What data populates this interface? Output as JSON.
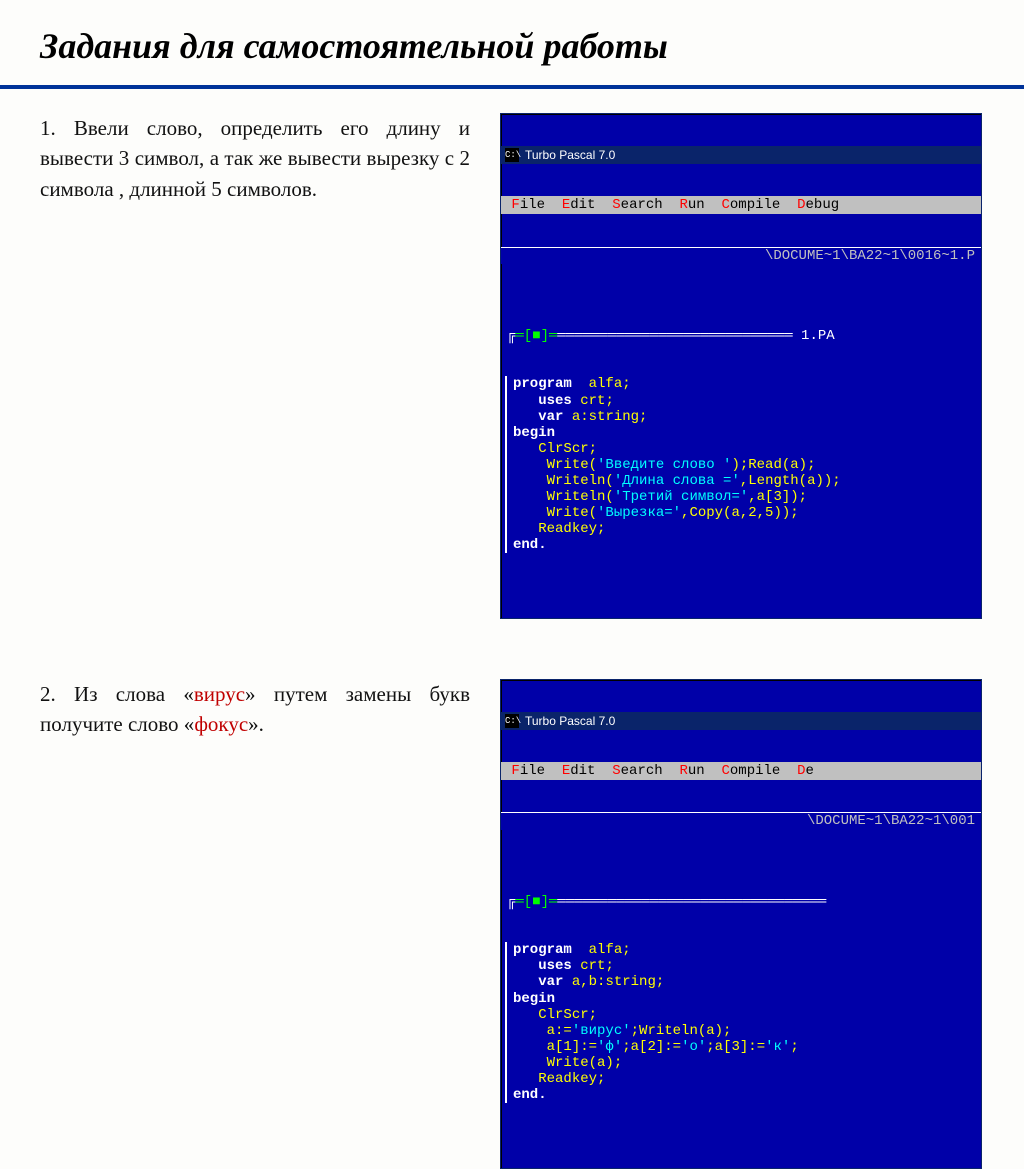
{
  "title": "Задания для самостоятельной работы",
  "tasks": [
    {
      "num": "1.",
      "body": "Ввели слово, определить его длину и вывести 3 символ, а так же вывести вырезку с 2 символа , длинной 5 символов.",
      "highlight_red_words": []
    },
    {
      "num": "2.",
      "body_pre": "Из слова «",
      "w1": "вирус",
      "body_mid": "» путем замены букв  получите слово «",
      "w2": "фокус",
      "body_post": "»."
    }
  ],
  "tp": {
    "title": "Turbo Pascal 7.0",
    "menu": {
      "file": "File",
      "edit": "Edit",
      "search": "Search",
      "run": "Run",
      "compile": "Compile",
      "debug": "Debug",
      "d2": "De"
    },
    "path1": "\\DOCUME~1\\BA22~1\\0016~1.P",
    "path2": "\\DOCUME~1\\BA22~1\\001",
    "frame_top1": "═[■]══════════════════════════════ 1.PA",
    "frame_top2": "═[■]══════════════════════════════════"
  },
  "code1": [
    {
      "t": "kw",
      "v": "program"
    },
    {
      "t": "txt",
      "v": "  "
    },
    {
      "t": "id",
      "v": "alfa;"
    },
    {
      "t": "nl"
    },
    {
      "t": "txt",
      "v": "   "
    },
    {
      "t": "kw",
      "v": "uses"
    },
    {
      "t": "txt",
      "v": " "
    },
    {
      "t": "id",
      "v": "crt;"
    },
    {
      "t": "nl"
    },
    {
      "t": "txt",
      "v": "   "
    },
    {
      "t": "kw",
      "v": "var"
    },
    {
      "t": "txt",
      "v": " "
    },
    {
      "t": "id",
      "v": "a:string;"
    },
    {
      "t": "nl"
    },
    {
      "t": "kw",
      "v": "begin"
    },
    {
      "t": "nl"
    },
    {
      "t": "txt",
      "v": "   "
    },
    {
      "t": "id",
      "v": "ClrScr;"
    },
    {
      "t": "nl"
    },
    {
      "t": "txt",
      "v": "    "
    },
    {
      "t": "id",
      "v": "Write("
    },
    {
      "t": "str",
      "v": "'Введите слово '"
    },
    {
      "t": "id",
      "v": ");Read(a);"
    },
    {
      "t": "nl"
    },
    {
      "t": "txt",
      "v": "    "
    },
    {
      "t": "id",
      "v": "Writeln("
    },
    {
      "t": "str",
      "v": "'Длина слова ='"
    },
    {
      "t": "id",
      "v": ",Length(a));"
    },
    {
      "t": "nl"
    },
    {
      "t": "txt",
      "v": "    "
    },
    {
      "t": "id",
      "v": "Writeln("
    },
    {
      "t": "str",
      "v": "'Третий символ='"
    },
    {
      "t": "id",
      "v": ",a[3]);"
    },
    {
      "t": "nl"
    },
    {
      "t": "txt",
      "v": "    "
    },
    {
      "t": "id",
      "v": "Write("
    },
    {
      "t": "str",
      "v": "'Вырезка='"
    },
    {
      "t": "id",
      "v": ",Copy(a,2,5));"
    },
    {
      "t": "nl"
    },
    {
      "t": "txt",
      "v": "   "
    },
    {
      "t": "id",
      "v": "Readkey;"
    },
    {
      "t": "nl"
    },
    {
      "t": "kw",
      "v": "end."
    }
  ],
  "code2": [
    {
      "t": "kw",
      "v": "program"
    },
    {
      "t": "txt",
      "v": "  "
    },
    {
      "t": "id",
      "v": "alfa;"
    },
    {
      "t": "nl"
    },
    {
      "t": "txt",
      "v": "   "
    },
    {
      "t": "kw",
      "v": "uses"
    },
    {
      "t": "txt",
      "v": " "
    },
    {
      "t": "id",
      "v": "crt;"
    },
    {
      "t": "nl"
    },
    {
      "t": "txt",
      "v": "   "
    },
    {
      "t": "kw",
      "v": "var"
    },
    {
      "t": "txt",
      "v": " "
    },
    {
      "t": "id",
      "v": "a,b:string;"
    },
    {
      "t": "nl"
    },
    {
      "t": "kw",
      "v": "begin"
    },
    {
      "t": "nl"
    },
    {
      "t": "txt",
      "v": "   "
    },
    {
      "t": "id",
      "v": "ClrScr;"
    },
    {
      "t": "nl"
    },
    {
      "t": "txt",
      "v": "    "
    },
    {
      "t": "id",
      "v": "a:="
    },
    {
      "t": "str",
      "v": "'вирус'"
    },
    {
      "t": "id",
      "v": ";Writeln(a);"
    },
    {
      "t": "nl"
    },
    {
      "t": "txt",
      "v": "    "
    },
    {
      "t": "id",
      "v": "a[1]:="
    },
    {
      "t": "str",
      "v": "'ф'"
    },
    {
      "t": "id",
      "v": ";a[2]:="
    },
    {
      "t": "str",
      "v": "'о'"
    },
    {
      "t": "id",
      "v": ";a[3]:="
    },
    {
      "t": "str",
      "v": "'к'"
    },
    {
      "t": "id",
      "v": ";"
    },
    {
      "t": "nl"
    },
    {
      "t": "txt",
      "v": "    "
    },
    {
      "t": "id",
      "v": "Write(a);"
    },
    {
      "t": "nl"
    },
    {
      "t": "txt",
      "v": "   "
    },
    {
      "t": "id",
      "v": "Readkey;"
    },
    {
      "t": "nl"
    },
    {
      "t": "kw",
      "v": "end."
    }
  ]
}
